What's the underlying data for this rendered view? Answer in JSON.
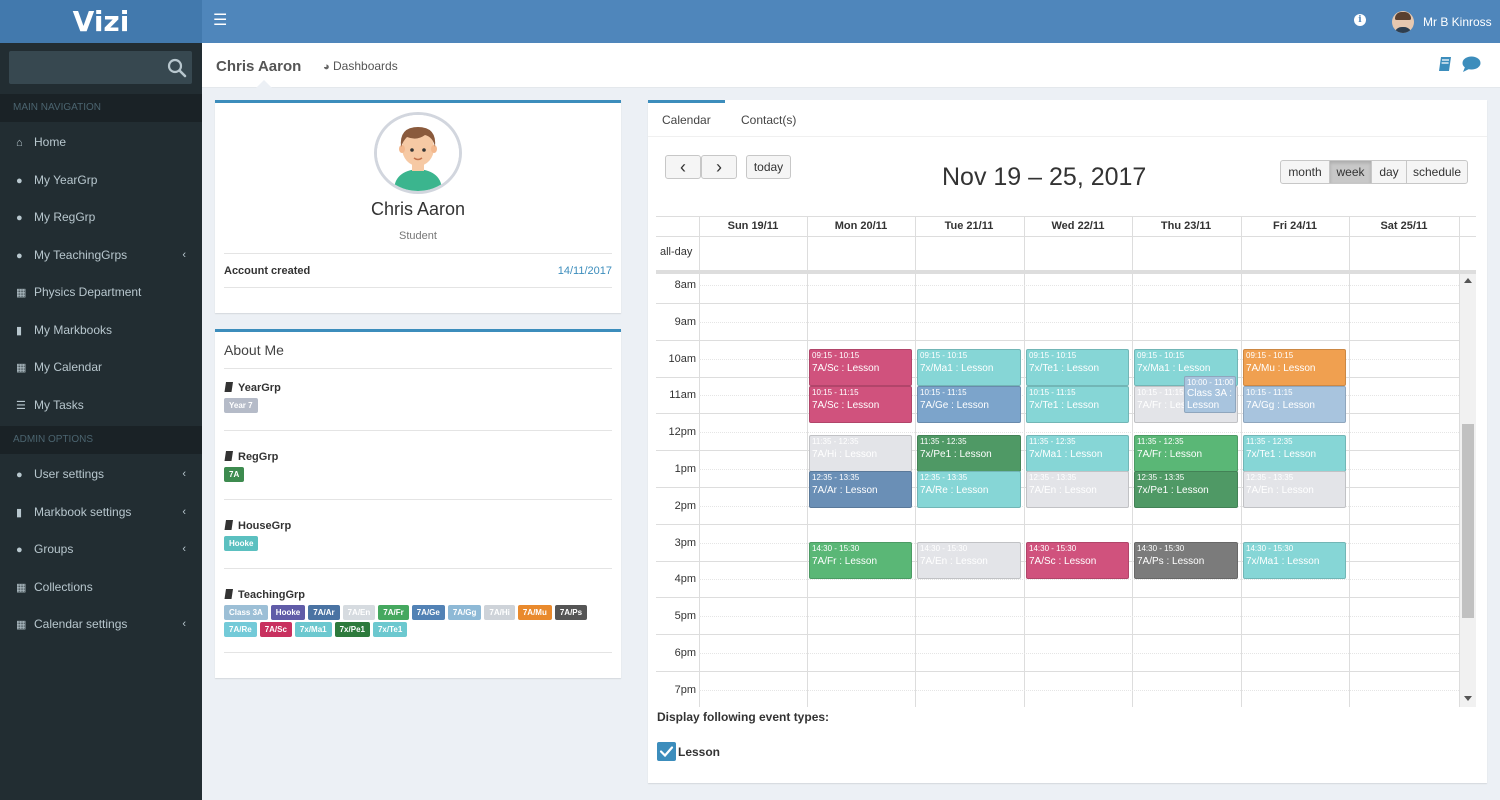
{
  "app": {
    "logo_text": "Vizi",
    "user_name": "Mr B Kinross"
  },
  "icons": [
    "menu-icon",
    "info-icon",
    "search-icon",
    "home-icon",
    "users-icon",
    "book-icon",
    "calendar-icon",
    "tasks-icon",
    "user-icon",
    "comment-icon",
    "dashboard-icon",
    "chevron-left-icon",
    "check-icon"
  ],
  "sidebar": {
    "search_placeholder": "",
    "headers": [
      "MAIN NAVIGATION",
      "ADMIN OPTIONS"
    ],
    "items": [
      {
        "label": "Home",
        "icon": "home-icon"
      },
      {
        "label": "My YearGrp",
        "icon": "users-icon"
      },
      {
        "label": "My RegGrp",
        "icon": "users-icon"
      },
      {
        "label": "My TeachingGrps",
        "icon": "users-icon"
      },
      {
        "label": "Physics Department",
        "icon": "department-icon"
      },
      {
        "label": "My Markbooks",
        "icon": "book-icon"
      },
      {
        "label": "My Calendar",
        "icon": "calendar-icon"
      },
      {
        "label": "My Tasks",
        "icon": "tasks-icon"
      },
      {
        "label": "User settings",
        "icon": "user-icon"
      },
      {
        "label": "Markbook settings",
        "icon": "book-icon"
      },
      {
        "label": "Groups",
        "icon": "users-icon"
      },
      {
        "label": "Collections",
        "icon": "collections-icon"
      },
      {
        "label": "Calendar settings",
        "icon": "calendar-icon"
      }
    ]
  },
  "header": {
    "title": "Chris Aaron",
    "dashboards_label": "Dashboards"
  },
  "profile": {
    "name": "Chris Aaron",
    "role": "Student",
    "account_created_label": "Account created",
    "account_created_value": "14/11/2017"
  },
  "about": {
    "title": "About Me",
    "sections": [
      {
        "label": "YearGrp",
        "tags": [
          {
            "text": "Year 7",
            "color": "#b5bbc8"
          }
        ]
      },
      {
        "label": "RegGrp",
        "tags": [
          {
            "text": "7A",
            "color": "#3d8b4f"
          }
        ]
      },
      {
        "label": "HouseGrp",
        "tags": [
          {
            "text": "Hooke",
            "color": "#5bc0c0"
          }
        ]
      },
      {
        "label": "TeachingGrp",
        "tags": [
          {
            "text": "Class 3A",
            "color": "#9cbfd6"
          },
          {
            "text": "Hooke",
            "color": "#605ca8"
          },
          {
            "text": "7A/Ar",
            "color": "#4a73a3"
          },
          {
            "text": "7A/En",
            "color": "#d6dbe0"
          },
          {
            "text": "7A/Fr",
            "color": "#45a85f"
          },
          {
            "text": "7A/Ge",
            "color": "#5282b5"
          },
          {
            "text": "7A/Gg",
            "color": "#8eb9d6"
          },
          {
            "text": "7A/Hi",
            "color": "#ced3d9"
          },
          {
            "text": "7A/Mu",
            "color": "#e98a2d"
          },
          {
            "text": "7A/Ps",
            "color": "#555555"
          },
          {
            "text": "7A/Re",
            "color": "#73cad8"
          },
          {
            "text": "7A/Sc",
            "color": "#c8315f"
          },
          {
            "text": "7x/Ma1",
            "color": "#6cc8cf"
          },
          {
            "text": "7x/Pe1",
            "color": "#2d7a3c"
          },
          {
            "text": "7x/Te1",
            "color": "#6cc8cf"
          }
        ]
      }
    ]
  },
  "calendar": {
    "tabs": [
      "Calendar",
      "Contact(s)"
    ],
    "title": "Nov 19 – 25, 2017",
    "today_label": "today",
    "prev_label": "‹",
    "next_label": "›",
    "views": [
      "month",
      "week",
      "day",
      "schedule"
    ],
    "active_view": "week",
    "days": [
      "Sun 19/11",
      "Mon 20/11",
      "Tue 21/11",
      "Wed 22/11",
      "Thu 23/11",
      "Fri 24/11",
      "Sat 25/11"
    ],
    "allday_label": "all-day",
    "hours": [
      "8am",
      "9am",
      "10am",
      "11am",
      "12pm",
      "1pm",
      "2pm",
      "3pm",
      "4pm",
      "5pm",
      "6pm",
      "7pm"
    ],
    "events": [
      {
        "day": 1,
        "start": "09:15",
        "end": "10:15",
        "time": "09:15 - 10:15",
        "title": "7A/Sc : Lesson",
        "color": "#d0527d"
      },
      {
        "day": 1,
        "start": "10:15",
        "end": "11:15",
        "time": "10:15 - 11:15",
        "title": "7A/Sc : Lesson",
        "color": "#d0527d"
      },
      {
        "day": 1,
        "start": "11:35",
        "end": "12:35",
        "time": "11:35 - 12:35",
        "title": "7A/Hi : Lesson",
        "color": "#e3e4e8"
      },
      {
        "day": 1,
        "start": "12:35",
        "end": "13:35",
        "time": "12:35 - 13:35",
        "title": "7A/Ar : Lesson",
        "color": "#6a8fb6"
      },
      {
        "day": 1,
        "start": "14:30",
        "end": "15:30",
        "time": "14:30 - 15:30",
        "title": "7A/Fr : Lesson",
        "color": "#5ab776"
      },
      {
        "day": 2,
        "start": "09:15",
        "end": "10:15",
        "time": "09:15 - 10:15",
        "title": "7x/Ma1 : Lesson",
        "color": "#86d6d6"
      },
      {
        "day": 2,
        "start": "10:15",
        "end": "11:15",
        "time": "10:15 - 11:15",
        "title": "7A/Ge : Lesson",
        "color": "#7ca4cb"
      },
      {
        "day": 2,
        "start": "11:35",
        "end": "12:35",
        "time": "11:35 - 12:35",
        "title": "7x/Pe1 : Lesson",
        "color": "#4f9965"
      },
      {
        "day": 2,
        "start": "12:35",
        "end": "13:35",
        "time": "12:35 - 13:35",
        "title": "7A/Re : Lesson",
        "color": "#86d6d6"
      },
      {
        "day": 2,
        "start": "14:30",
        "end": "15:30",
        "time": "14:30 - 15:30",
        "title": "7A/En : Lesson",
        "color": "#e3e4e8"
      },
      {
        "day": 3,
        "start": "09:15",
        "end": "10:15",
        "time": "09:15 - 10:15",
        "title": "7x/Te1 : Lesson",
        "color": "#86d6d6"
      },
      {
        "day": 3,
        "start": "10:15",
        "end": "11:15",
        "time": "10:15 - 11:15",
        "title": "7x/Te1 : Lesson",
        "color": "#86d6d6"
      },
      {
        "day": 3,
        "start": "11:35",
        "end": "12:35",
        "time": "11:35 - 12:35",
        "title": "7x/Ma1 : Lesson",
        "color": "#86d6d6"
      },
      {
        "day": 3,
        "start": "12:35",
        "end": "13:35",
        "time": "12:35 - 13:35",
        "title": "7A/En : Lesson",
        "color": "#e3e4e8"
      },
      {
        "day": 3,
        "start": "14:30",
        "end": "15:30",
        "time": "14:30 - 15:30",
        "title": "7A/Sc : Lesson",
        "color": "#d0527d"
      },
      {
        "day": 4,
        "start": "09:15",
        "end": "10:15",
        "time": "09:15 - 10:15",
        "title": "7x/Ma1 : Lesson",
        "color": "#86d6d6"
      },
      {
        "day": 4,
        "start": "10:15",
        "end": "11:15",
        "time": "10:15 - 11:15",
        "title": "7A/Fr : Lesson",
        "color": "#e3e4e8"
      },
      {
        "day": 4,
        "start": "10:00",
        "end": "11:00",
        "time": "10:00 - 11:00",
        "title": "Class 3A : Lesson",
        "color": "#a8c4de",
        "overlap": true
      },
      {
        "day": 4,
        "start": "11:35",
        "end": "12:35",
        "time": "11:35 - 12:35",
        "title": "7A/Fr : Lesson",
        "color": "#5ab776"
      },
      {
        "day": 4,
        "start": "12:35",
        "end": "13:35",
        "time": "12:35 - 13:35",
        "title": "7x/Pe1 : Lesson",
        "color": "#4f9965"
      },
      {
        "day": 4,
        "start": "14:30",
        "end": "15:30",
        "time": "14:30 - 15:30",
        "title": "7A/Ps : Lesson",
        "color": "#7b7b7b"
      },
      {
        "day": 5,
        "start": "09:15",
        "end": "10:15",
        "time": "09:15 - 10:15",
        "title": "7A/Mu : Lesson",
        "color": "#f0a050"
      },
      {
        "day": 5,
        "start": "10:15",
        "end": "11:15",
        "time": "10:15 - 11:15",
        "title": "7A/Gg : Lesson",
        "color": "#a8c4de"
      },
      {
        "day": 5,
        "start": "11:35",
        "end": "12:35",
        "time": "11:35 - 12:35",
        "title": "7x/Te1 : Lesson",
        "color": "#86d6d6"
      },
      {
        "day": 5,
        "start": "12:35",
        "end": "13:35",
        "time": "12:35 - 13:35",
        "title": "7A/En : Lesson",
        "color": "#e3e4e8"
      },
      {
        "day": 5,
        "start": "14:30",
        "end": "15:30",
        "time": "14:30 - 15:30",
        "title": "7x/Ma1 : Lesson",
        "color": "#86d6d6"
      }
    ],
    "display_label": "Display following event types:",
    "event_types": [
      {
        "label": "Lesson",
        "checked": true
      }
    ]
  },
  "colors": {
    "topbar": "#4f86bb",
    "sidebar": "#222d32",
    "accent": "#3c8dbc"
  }
}
